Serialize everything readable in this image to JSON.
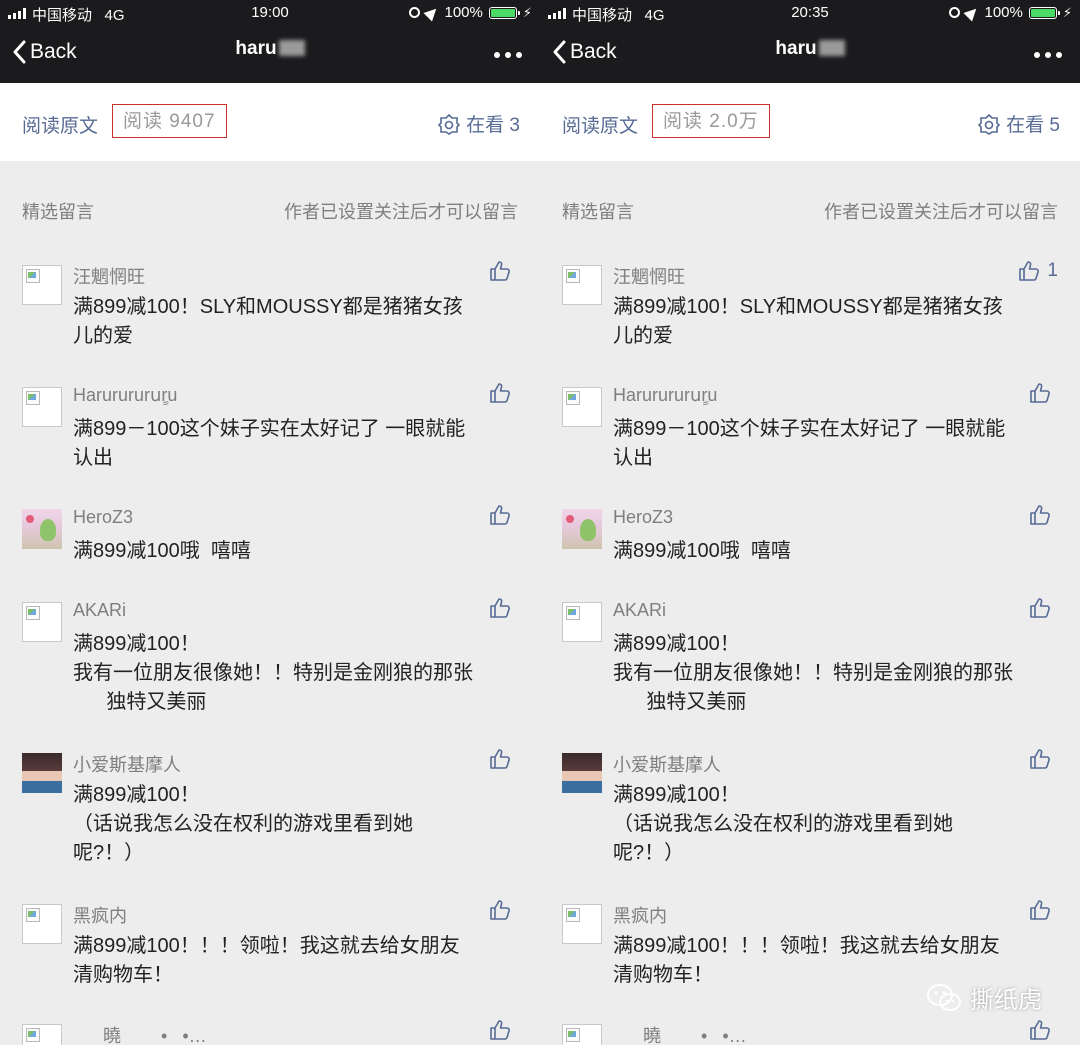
{
  "panels": [
    {
      "status": {
        "carrier": "中国移动",
        "network": "4G",
        "time": "19:00",
        "battery": "100%"
      },
      "nav": {
        "back_label": "Back",
        "title": "haru"
      },
      "read_row": {
        "original_link": "阅读原文",
        "read_count": "阅读 9407",
        "watching": "在看 3"
      },
      "comments_header": {
        "title": "精选留言",
        "note": "作者已设置关注后才可以留言"
      },
      "comments": [
        {
          "nick": "汪魍惘旺",
          "content": "满899减100！SLY和MOUSSY都是猪猪女孩\n儿的爱",
          "likes": ""
        },
        {
          "nick": "Harurururuٍru",
          "content": "满899－100这个妹子实在太好记了 一眼就能\n认出",
          "likes": ""
        },
        {
          "nick": "HeroZ3",
          "content": "满899减100哦  嘻嘻",
          "likes": ""
        },
        {
          "nick": "AKARi",
          "content": "满899减100！\n我有一位朋友很像她！！特别是金刚狼的那张\n      独特又美丽",
          "likes": ""
        },
        {
          "nick": "小爱斯基摩人",
          "content": "满899减100！\n（话说我怎么没在权利的游戏里看到她\n呢?！）",
          "likes": ""
        },
        {
          "nick": "黑疯内",
          "content": "满899减100！！！领啦！我这就去给女朋友\n清购物车！",
          "likes": ""
        },
        {
          "nick": "      曉        •   •…",
          "content": "",
          "likes": ""
        }
      ]
    },
    {
      "status": {
        "carrier": "中国移动",
        "network": "4G",
        "time": "20:35",
        "battery": "100%"
      },
      "nav": {
        "back_label": "Back",
        "title": "haru"
      },
      "read_row": {
        "original_link": "阅读原文",
        "read_count": "阅读 2.0万",
        "watching": "在看 5"
      },
      "comments_header": {
        "title": "精选留言",
        "note": "作者已设置关注后才可以留言"
      },
      "comments": [
        {
          "nick": "汪魍惘旺",
          "content": "满899减100！SLY和MOUSSY都是猪猪女孩\n儿的爱",
          "likes": "1"
        },
        {
          "nick": "Harurururuٍru",
          "content": "满899－100这个妹子实在太好记了 一眼就能\n认出",
          "likes": ""
        },
        {
          "nick": "HeroZ3",
          "content": "满899减100哦  嘻嘻",
          "likes": ""
        },
        {
          "nick": "AKARi",
          "content": "满899减100！\n我有一位朋友很像她！！特别是金刚狼的那张\n      独特又美丽",
          "likes": ""
        },
        {
          "nick": "小爱斯基摩人",
          "content": "满899减100！\n（话说我怎么没在权利的游戏里看到她\n呢?！）",
          "likes": ""
        },
        {
          "nick": "黑疯内",
          "content": "满899减100！！！领啦！我这就去给女朋友\n清购物车！",
          "likes": ""
        },
        {
          "nick": "      曉        •   •…",
          "content": "",
          "likes": ""
        }
      ]
    }
  ],
  "watermark": "撕纸虎",
  "colors": {
    "link": "#576b95",
    "highlight_box": "#c9302c",
    "topbar": "#1b1b1d",
    "battery": "#4cd964"
  },
  "icons": [
    "signal-icon",
    "orientation-lock-icon",
    "location-icon",
    "battery-icon",
    "back-chevron-icon",
    "more-icon",
    "watching-icon",
    "thumbs-up-icon",
    "wechat-icon"
  ]
}
